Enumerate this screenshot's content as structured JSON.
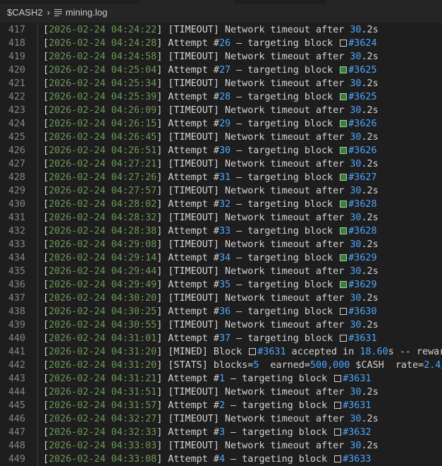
{
  "breadcrumb": {
    "folder": "$CASH2",
    "file": "mining.log"
  },
  "colors": {
    "timestamp": "#6a9955",
    "number": "#4fa6ff",
    "text": "#d4d4d4",
    "gutter": "#858585",
    "background": "#1e1e1e"
  },
  "lines": [
    {
      "n": "417",
      "ts": "2026-02-24 04:24:22",
      "kind": "timeout",
      "text": "[TIMEOUT] Network timeout after ",
      "num": "30",
      "tail": ".2s"
    },
    {
      "n": "418",
      "ts": "2026-02-24 04:24:28",
      "kind": "attempt",
      "text": "Attempt #",
      "num": "26",
      "mid": " – targeting block ",
      "box": "empty",
      "block": "#3624"
    },
    {
      "n": "419",
      "ts": "2026-02-24 04:24:58",
      "kind": "timeout",
      "text": "[TIMEOUT] Network timeout after ",
      "num": "30",
      "tail": ".2s"
    },
    {
      "n": "420",
      "ts": "2026-02-24 04:25:04",
      "kind": "attempt",
      "text": "Attempt #",
      "num": "27",
      "mid": " – targeting block ",
      "box": "green",
      "block": "#3625"
    },
    {
      "n": "421",
      "ts": "2026-02-24 04:25:34",
      "kind": "timeout",
      "text": "[TIMEOUT] Network timeout after ",
      "num": "30",
      "tail": ".2s"
    },
    {
      "n": "422",
      "ts": "2026-02-24 04:25:39",
      "kind": "attempt",
      "text": "Attempt #",
      "num": "28",
      "mid": " – targeting block ",
      "box": "green",
      "block": "#3625"
    },
    {
      "n": "423",
      "ts": "2026-02-24 04:26:09",
      "kind": "timeout",
      "text": "[TIMEOUT] Network timeout after ",
      "num": "30",
      "tail": ".2s"
    },
    {
      "n": "424",
      "ts": "2026-02-24 04:26:15",
      "kind": "attempt",
      "text": "Attempt #",
      "num": "29",
      "mid": " – targeting block ",
      "box": "green",
      "block": "#3626"
    },
    {
      "n": "425",
      "ts": "2026-02-24 04:26:45",
      "kind": "timeout",
      "text": "[TIMEOUT] Network timeout after ",
      "num": "30",
      "tail": ".2s"
    },
    {
      "n": "426",
      "ts": "2026-02-24 04:26:51",
      "kind": "attempt",
      "text": "Attempt #",
      "num": "30",
      "mid": " – targeting block ",
      "box": "green",
      "block": "#3626"
    },
    {
      "n": "427",
      "ts": "2026-02-24 04:27:21",
      "kind": "timeout",
      "text": "[TIMEOUT] Network timeout after ",
      "num": "30",
      "tail": ".2s"
    },
    {
      "n": "428",
      "ts": "2026-02-24 04:27:26",
      "kind": "attempt",
      "text": "Attempt #",
      "num": "31",
      "mid": " – targeting block ",
      "box": "green",
      "block": "#3627"
    },
    {
      "n": "429",
      "ts": "2026-02-24 04:27:57",
      "kind": "timeout",
      "text": "[TIMEOUT] Network timeout after ",
      "num": "30",
      "tail": ".2s"
    },
    {
      "n": "430",
      "ts": "2026-02-24 04:28:02",
      "kind": "attempt",
      "text": "Attempt #",
      "num": "32",
      "mid": " – targeting block ",
      "box": "green",
      "block": "#3628"
    },
    {
      "n": "431",
      "ts": "2026-02-24 04:28:32",
      "kind": "timeout",
      "text": "[TIMEOUT] Network timeout after ",
      "num": "30",
      "tail": ".2s"
    },
    {
      "n": "432",
      "ts": "2026-02-24 04:28:38",
      "kind": "attempt",
      "text": "Attempt #",
      "num": "33",
      "mid": " – targeting block ",
      "box": "green",
      "block": "#3628"
    },
    {
      "n": "433",
      "ts": "2026-02-24 04:29:08",
      "kind": "timeout",
      "text": "[TIMEOUT] Network timeout after ",
      "num": "30",
      "tail": ".2s"
    },
    {
      "n": "434",
      "ts": "2026-02-24 04:29:14",
      "kind": "attempt",
      "text": "Attempt #",
      "num": "34",
      "mid": " – targeting block ",
      "box": "green",
      "block": "#3629"
    },
    {
      "n": "435",
      "ts": "2026-02-24 04:29:44",
      "kind": "timeout",
      "text": "[TIMEOUT] Network timeout after ",
      "num": "30",
      "tail": ".2s"
    },
    {
      "n": "436",
      "ts": "2026-02-24 04:29:49",
      "kind": "attempt",
      "text": "Attempt #",
      "num": "35",
      "mid": " – targeting block ",
      "box": "green",
      "block": "#3629"
    },
    {
      "n": "437",
      "ts": "2026-02-24 04:30:20",
      "kind": "timeout",
      "text": "[TIMEOUT] Network timeout after ",
      "num": "30",
      "tail": ".2s"
    },
    {
      "n": "438",
      "ts": "2026-02-24 04:30:25",
      "kind": "attempt",
      "text": "Attempt #",
      "num": "36",
      "mid": " – targeting block ",
      "box": "empty",
      "block": "#3630"
    },
    {
      "n": "439",
      "ts": "2026-02-24 04:30:55",
      "kind": "timeout",
      "text": "[TIMEOUT] Network timeout after ",
      "num": "30",
      "tail": ".2s"
    },
    {
      "n": "440",
      "ts": "2026-02-24 04:31:01",
      "kind": "attempt",
      "text": "Attempt #",
      "num": "37",
      "mid": " – targeting block ",
      "box": "empty",
      "block": "#3631"
    },
    {
      "n": "441",
      "ts": "2026-02-24 04:31:20",
      "kind": "mined",
      "text": "[MINED] Block ",
      "box": "empty",
      "block": "#3631",
      "mid": " accepted in ",
      "num": "18.60",
      "tail": "s -- reward"
    },
    {
      "n": "442",
      "ts": "2026-02-24 04:31:20",
      "kind": "stats",
      "text": "[STATS] blocks=",
      "num": "5",
      "mid": "  earned=",
      "num2": "500,000",
      "mid2": " $CASH  rate=",
      "num3": "2.4",
      "tail": "/hr"
    },
    {
      "n": "443",
      "ts": "2026-02-24 04:31:21",
      "kind": "attempt",
      "text": "Attempt #",
      "num": "1",
      "mid": " – targeting block ",
      "box": "empty",
      "block": "#3631"
    },
    {
      "n": "444",
      "ts": "2026-02-24 04:31:51",
      "kind": "timeout",
      "text": "[TIMEOUT] Network timeout after ",
      "num": "30",
      "tail": ".2s"
    },
    {
      "n": "445",
      "ts": "2026-02-24 04:31:57",
      "kind": "attempt",
      "text": "Attempt #",
      "num": "2",
      "mid": " – targeting block ",
      "box": "empty",
      "block": "#3631"
    },
    {
      "n": "446",
      "ts": "2026-02-24 04:32:27",
      "kind": "timeout",
      "text": "[TIMEOUT] Network timeout after ",
      "num": "30",
      "tail": ".2s"
    },
    {
      "n": "447",
      "ts": "2026-02-24 04:32:33",
      "kind": "attempt",
      "text": "Attempt #",
      "num": "3",
      "mid": " – targeting block ",
      "box": "empty",
      "block": "#3632"
    },
    {
      "n": "448",
      "ts": "2026-02-24 04:33:03",
      "kind": "timeout",
      "text": "[TIMEOUT] Network timeout after ",
      "num": "30",
      "tail": ".2s"
    },
    {
      "n": "449",
      "ts": "2026-02-24 04:33:08",
      "kind": "attempt",
      "text": "Attempt #",
      "num": "4",
      "mid": " – targeting block ",
      "box": "empty",
      "block": "#3633"
    }
  ]
}
